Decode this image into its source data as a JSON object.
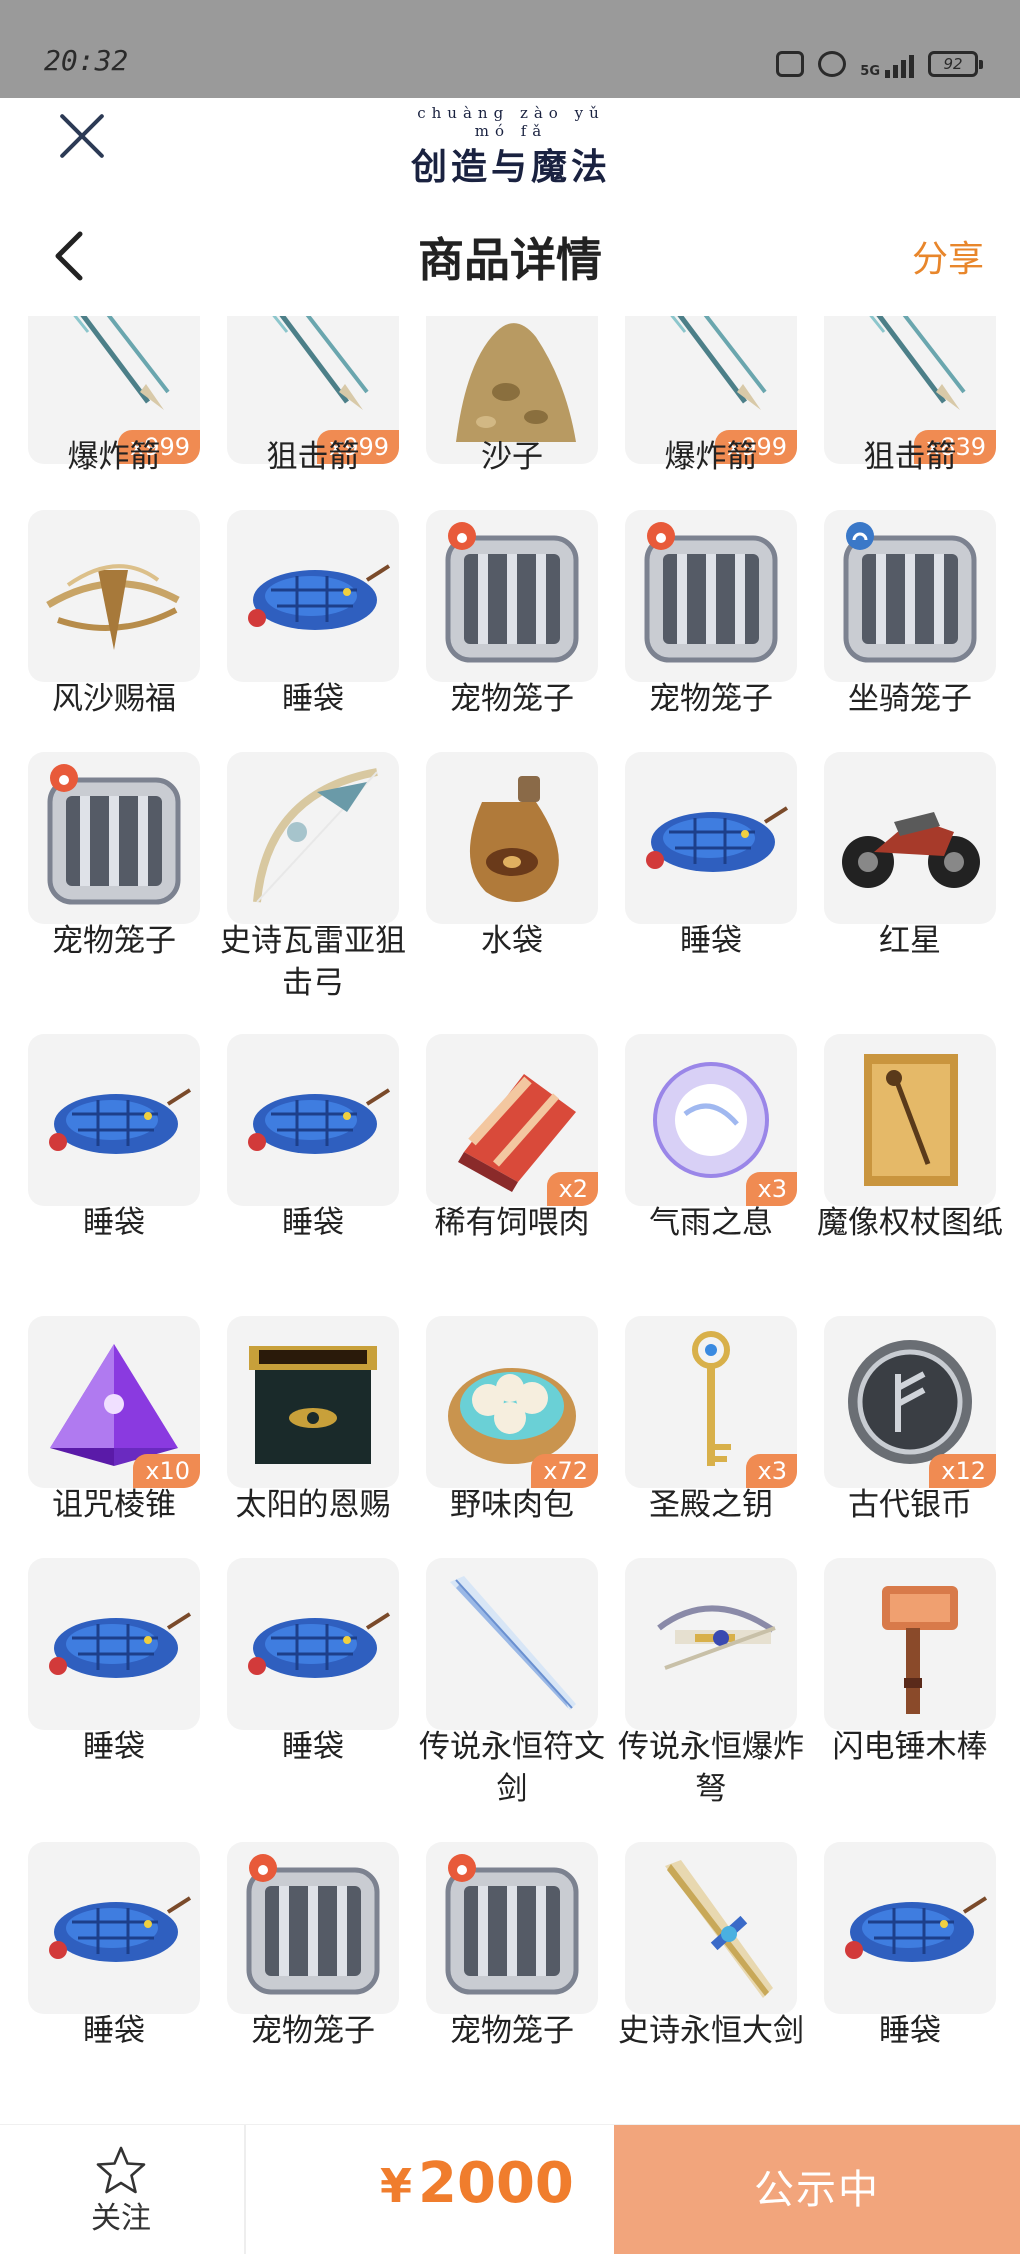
{
  "status_bar": {
    "time": "20:32",
    "network": "5G",
    "battery": "92"
  },
  "topbar": {
    "game_pinyin": "chuàng zào yǔ mó fǎ",
    "game_name": "创造与魔法"
  },
  "header": {
    "title": "商品详情",
    "share": "分享"
  },
  "items": [
    {
      "name": "爆炸箭",
      "qty": "x999",
      "icon": "arrow-icon"
    },
    {
      "name": "狙击箭",
      "qty": "x999",
      "icon": "arrow-icon"
    },
    {
      "name": "沙子",
      "qty": "",
      "icon": "sand-icon"
    },
    {
      "name": "爆炸箭",
      "qty": "x999",
      "icon": "arrow-icon"
    },
    {
      "name": "狙击箭",
      "qty": "x839",
      "icon": "arrow-icon"
    },
    {
      "name": "风沙赐福",
      "qty": "",
      "icon": "sand-whirl-icon"
    },
    {
      "name": "睡袋",
      "qty": "",
      "icon": "sleeping-bag-icon"
    },
    {
      "name": "宠物笼子",
      "qty": "",
      "icon": "pet-cage-icon"
    },
    {
      "name": "宠物笼子",
      "qty": "",
      "icon": "pet-cage-icon"
    },
    {
      "name": "坐骑笼子",
      "qty": "",
      "icon": "mount-cage-icon"
    },
    {
      "name": "宠物笼子",
      "qty": "",
      "icon": "pet-cage-icon"
    },
    {
      "name": "史诗瓦雷亚狙击弓",
      "qty": "",
      "icon": "bow-icon"
    },
    {
      "name": "水袋",
      "qty": "",
      "icon": "water-bag-icon"
    },
    {
      "name": "睡袋",
      "qty": "",
      "icon": "sleeping-bag-icon"
    },
    {
      "name": "红星",
      "qty": "",
      "icon": "motorcycle-icon"
    },
    {
      "name": "睡袋",
      "qty": "",
      "icon": "sleeping-bag-icon"
    },
    {
      "name": "睡袋",
      "qty": "",
      "icon": "sleeping-bag-icon"
    },
    {
      "name": "稀有饲喂肉",
      "qty": "x2",
      "icon": "meat-icon"
    },
    {
      "name": "气雨之息",
      "qty": "x3",
      "icon": "orb-icon"
    },
    {
      "name": "魔像权杖图纸",
      "qty": "",
      "icon": "scroll-icon"
    },
    {
      "name": "诅咒棱锥",
      "qty": "x10",
      "icon": "pyramid-icon"
    },
    {
      "name": "太阳的恩赐",
      "qty": "",
      "icon": "chest-icon"
    },
    {
      "name": "野味肉包",
      "qty": "x72",
      "icon": "bun-icon"
    },
    {
      "name": "圣殿之钥",
      "qty": "x3",
      "icon": "key-icon"
    },
    {
      "name": "古代银币",
      "qty": "x12",
      "icon": "coin-icon"
    },
    {
      "name": "睡袋",
      "qty": "",
      "icon": "sleeping-bag-icon"
    },
    {
      "name": "睡袋",
      "qty": "",
      "icon": "sleeping-bag-icon"
    },
    {
      "name": "传说永恒符文剑",
      "qty": "",
      "icon": "rune-sword-icon"
    },
    {
      "name": "传说永恒爆炸弩",
      "qty": "",
      "icon": "crossbow-icon"
    },
    {
      "name": "闪电锤木棒",
      "qty": "",
      "icon": "hammer-icon"
    },
    {
      "name": "睡袋",
      "qty": "",
      "icon": "sleeping-bag-icon"
    },
    {
      "name": "宠物笼子",
      "qty": "",
      "icon": "pet-cage-icon"
    },
    {
      "name": "宠物笼子",
      "qty": "",
      "icon": "pet-cage-icon"
    },
    {
      "name": "史诗永恒大剑",
      "qty": "",
      "icon": "great-sword-icon"
    },
    {
      "name": "睡袋",
      "qty": "",
      "icon": "sleeping-bag-icon"
    }
  ],
  "bottom_bar": {
    "follow_label": "关注",
    "currency": "¥",
    "price": "2000",
    "status_button": "公示中"
  },
  "colors": {
    "accent": "#f07d2d",
    "badge": "#f08b52",
    "status_button": "#f2a57c"
  }
}
